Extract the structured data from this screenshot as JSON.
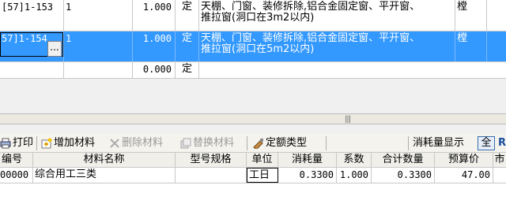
{
  "top_grid": {
    "rows": [
      {
        "code": "[57]1-153",
        "num": "1",
        "qty": "1.000",
        "type": "定",
        "desc_line1": "天棚、门窗、装修拆除,铝合金固定窗、平开窗、",
        "desc_line2": "推拉窗(洞口在3m2以内)",
        "extra": "樘"
      },
      {
        "code": "57]1-154",
        "num": "1",
        "qty": "1.000",
        "type": "定",
        "desc_line1": "天棚、门窗、装修拆除,铝合金固定窗、平开窗、",
        "desc_line2": "推拉窗(洞口在5m2以内)",
        "extra": "樘",
        "ellipsis": "..."
      },
      {
        "code": "",
        "num": "",
        "qty": "0.000",
        "type": "定",
        "desc_line1": "",
        "desc_line2": "",
        "extra": ""
      }
    ]
  },
  "splitter": {
    "grip": "|||"
  },
  "toolbar": {
    "print": "打印",
    "add_material": "增加材料",
    "delete_material": "删除材料",
    "replace_material": "替换材料",
    "quota_type": "定额类型",
    "consumption_display": "消耗量显示",
    "all_label": "全",
    "r_label": "R"
  },
  "material_table": {
    "headers": [
      "编号",
      "材料名称",
      "型号规格",
      "单位",
      "消耗量",
      "系数",
      "合计数量",
      "预算价",
      "市"
    ],
    "rows": [
      {
        "code": "00000",
        "name": "综合用工三类",
        "spec": "",
        "unit": "工日",
        "consumption": "0.3300",
        "coef": "1.000",
        "total": "0.3300",
        "price": "47.00",
        "market": ""
      }
    ]
  },
  "colors": {
    "selection": "#3399ff",
    "grid_line": "#c8c8c8"
  }
}
